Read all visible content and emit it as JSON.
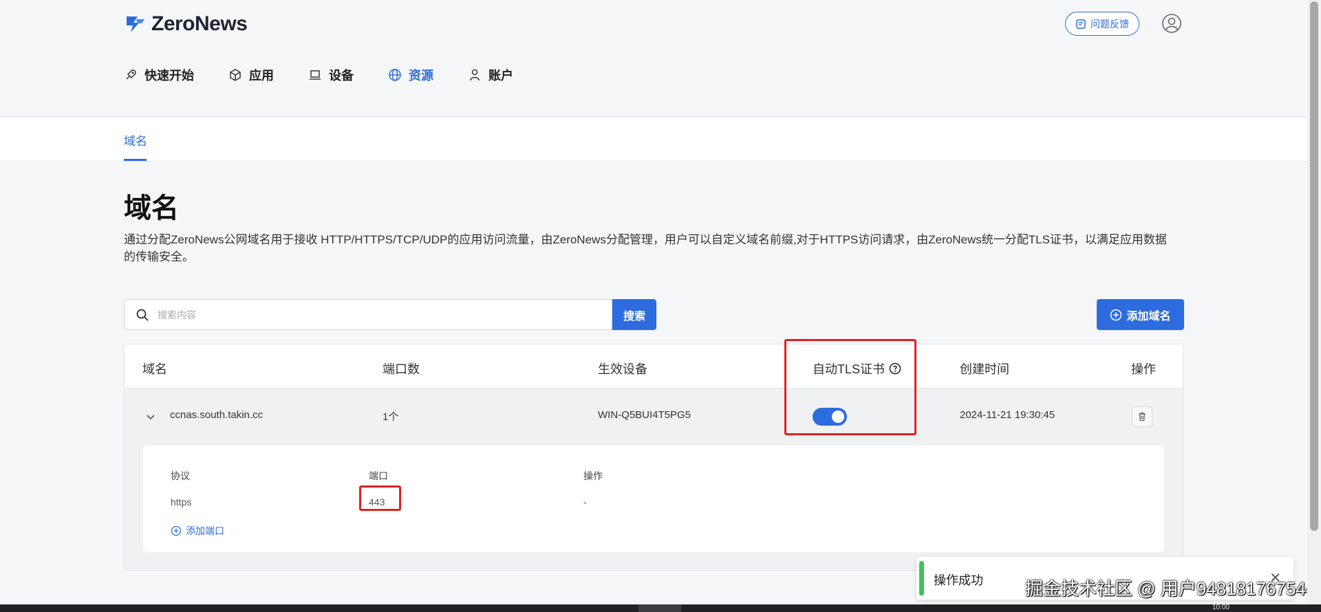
{
  "app": {
    "logo_text": "ZeroNews",
    "feedback_label": "问题反馈"
  },
  "nav": {
    "items": [
      {
        "label": "快速开始",
        "icon": "rocket-icon"
      },
      {
        "label": "应用",
        "icon": "cube-icon"
      },
      {
        "label": "设备",
        "icon": "laptop-icon"
      },
      {
        "label": "资源",
        "icon": "globe-icon",
        "active": true
      },
      {
        "label": "账户",
        "icon": "user-icon"
      }
    ]
  },
  "subnav": {
    "tab": "域名"
  },
  "page": {
    "title": "域名",
    "description": "通过分配ZeroNews公网域名用于接收 HTTP/HTTPS/TCP/UDP的应用访问流量，由ZeroNews分配管理，用户可以自定义域名前缀,对于HTTPS访问请求，由ZeroNews统一分配TLS证书，以满足应用数据的传输安全。"
  },
  "search": {
    "placeholder": "搜索内容",
    "button_label": "搜索"
  },
  "add_domain_label": "添加域名",
  "table": {
    "headers": [
      "域名",
      "端口数",
      "生效设备",
      "自动TLS证书",
      "创建时间",
      "操作"
    ],
    "rows": [
      {
        "domain": "ccnas.south.takin.cc",
        "ports": "1个",
        "device": "WIN-Q5BUI4T5PG5",
        "auto_tls": true,
        "created": "2024-11-21 19:30:45"
      }
    ]
  },
  "subtable": {
    "headers": [
      "协议",
      "端口",
      "操作"
    ],
    "rows": [
      {
        "protocol": "https",
        "port": "443",
        "action": "-"
      }
    ],
    "add_port_label": "添加端口"
  },
  "toast": {
    "message": "操作成功"
  },
  "watermark": "掘金技术社区 @ 用户948181767544",
  "taskbar": {
    "clock": "10:00"
  },
  "colors": {
    "accent": "#2d6cdf",
    "highlight": "#e02020",
    "success": "#3cc35a"
  }
}
